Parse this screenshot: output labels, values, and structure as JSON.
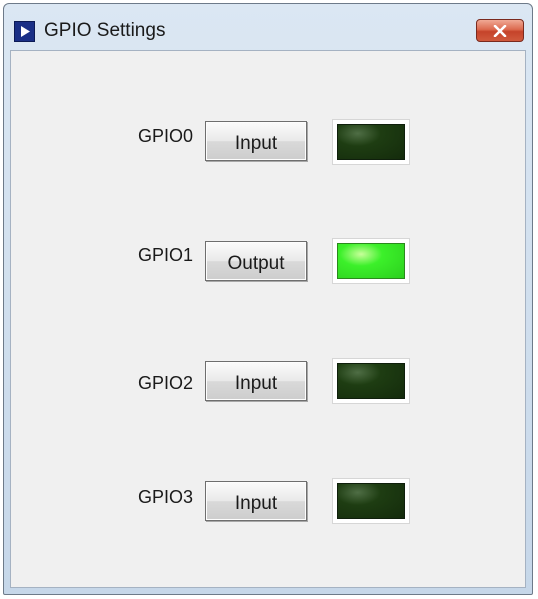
{
  "window": {
    "title": "GPIO Settings"
  },
  "gpios": [
    {
      "label": "GPIO0",
      "mode": "Input",
      "led_on": false
    },
    {
      "label": "GPIO1",
      "mode": "Output",
      "led_on": true
    },
    {
      "label": "GPIO2",
      "mode": "Input",
      "led_on": false
    },
    {
      "label": "GPIO3",
      "mode": "Input",
      "led_on": false
    }
  ],
  "colors": {
    "led_on": "#3cf02a",
    "led_off": "#1e3d12"
  }
}
